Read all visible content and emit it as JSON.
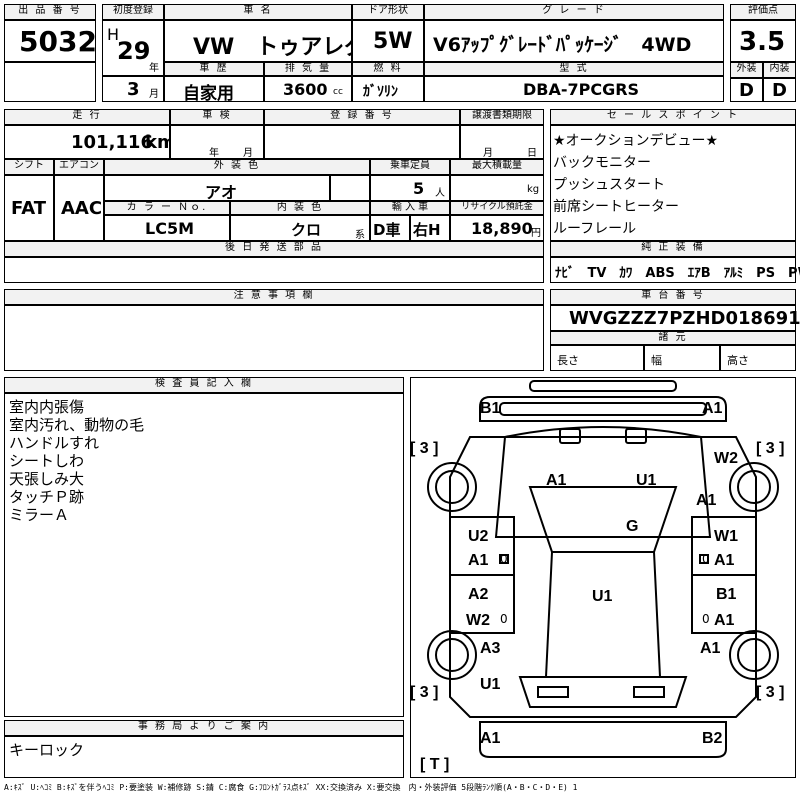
{
  "lot": {
    "label": "出 品 番 号",
    "value": "5032"
  },
  "first_reg": {
    "label": "初度登録",
    "era": "H",
    "year": "29",
    "year_unit": "年",
    "month": "3",
    "month_unit": "月"
  },
  "car_name": {
    "label": "車 名",
    "value": "VW　トゥアレグ"
  },
  "door": {
    "label": "ドア形状",
    "value": "5W"
  },
  "grade": {
    "label": "グ レ ー ド",
    "value": "V6ｱｯﾌﾟｸﾞﾚｰﾄﾞﾊﾟｯｹｰｼﾞ　4WD"
  },
  "score": {
    "label": "評価点",
    "value": "3.5",
    "ext_label": "外装",
    "int_label": "内装",
    "ext": "D",
    "int": "D"
  },
  "history": {
    "label": "車 歴",
    "value": "自家用"
  },
  "displacement": {
    "label": "排 気 量",
    "value": "3600",
    "unit": "cc"
  },
  "fuel": {
    "label": "燃 料",
    "value": "ｶﾞｿﾘﾝ"
  },
  "model": {
    "label": "型 式",
    "value": "DBA-7PCGRS"
  },
  "mileage": {
    "label": "走 行",
    "value": "101,116",
    "unit": "km"
  },
  "inspection": {
    "label": "車 検",
    "year_unit": "年",
    "month_unit": "月"
  },
  "registration": {
    "label": "登 録 番 号"
  },
  "transfer": {
    "label": "譲渡書類期限",
    "month_unit": "月",
    "day_unit": "日"
  },
  "sales_points": {
    "label": "セ ー ル ス ポ イ ン ト",
    "items": [
      "★オークションデビュー★",
      "バックモニター",
      "プッシュスタート",
      "前席シートヒーター",
      "ルーフレール"
    ]
  },
  "shift": {
    "label": "シフト",
    "value": "FAT"
  },
  "aircon": {
    "label": "エアコン",
    "value": "AAC"
  },
  "ext_color": {
    "label": "外 装 色",
    "value": "アオ"
  },
  "capacity": {
    "label": "乗車定員",
    "value": "5",
    "unit": "人"
  },
  "max_load": {
    "label": "最大積載量",
    "unit": "kg"
  },
  "color_no": {
    "label": "カ ラ ー Ｎｏ.",
    "value": "LC5M"
  },
  "int_color": {
    "label": "内 装 色",
    "value": "クロ",
    "suffix": "系"
  },
  "import": {
    "label": "輸 入 車",
    "value1": "D車",
    "value2": "右H"
  },
  "recycle": {
    "label": "リサイクル預託金",
    "value": "18,890",
    "unit": "円"
  },
  "later_parts": {
    "label": "後 日 発 送 部 品"
  },
  "equipment": {
    "label": "純 正 装 備",
    "value": "ﾅﾋﾞ　TV　ｶﾜ　ABS　ｴｱB　ｱﾙﾐ　PS　PW"
  },
  "caution": {
    "label": "注 意 事 項 欄"
  },
  "chassis": {
    "label": "車 台 番 号",
    "value": "WVGZZZ7PZHD018691"
  },
  "specs": {
    "label": "諸 元",
    "length": "長さ",
    "width": "幅",
    "height": "高さ"
  },
  "inspector": {
    "label": "検 査 員 記 入 欄",
    "items": [
      "室内内張傷",
      "室内汚れ、動物の毛",
      "ハンドルすれ",
      "シートしわ",
      "天張しみ大",
      "タッチＰ跡",
      "ミラーＡ"
    ]
  },
  "office": {
    "label": "事 務 局 よ り ご 案 内",
    "value": "キーロック"
  },
  "diagram": {
    "front_left": "B1",
    "front_right": "A1",
    "tire_fl": "3",
    "tire_fr": "3",
    "tire_rl": "3",
    "tire_rr": "3",
    "tire_t": "T",
    "w2_front": "W2",
    "a1_fender": "A1",
    "a1_hood": "A1",
    "u1_hood": "U1",
    "g_glass": "G",
    "u2_door": "U2",
    "a1_door_l": "A1",
    "w1_door": "W1",
    "a1_door_r": "A1",
    "a2_door": "A2",
    "w2_door": "W2",
    "b1_door": "B1",
    "a1_door_r2": "A1",
    "u1_roof": "U1",
    "a3_qtr": "A3",
    "a1_qtr": "A1",
    "u1_rear": "U1",
    "rear_left": "A1",
    "rear_right": "B2",
    "zero": "0"
  },
  "legend": "A:ｷｽﾞ U:ﾍｺﾐ B:ｷｽﾞを伴うﾍｺﾐ P:要塗装 W:補修跡 S:錆 C:腐食 G:ﾌﾛﾝﾄｶﾞﾗｽ点ｷｽﾞ XX:交換済み X:要交換　内・外装評価 5段階ﾗﾝｸ順(A・B・C・D・E) 1"
}
